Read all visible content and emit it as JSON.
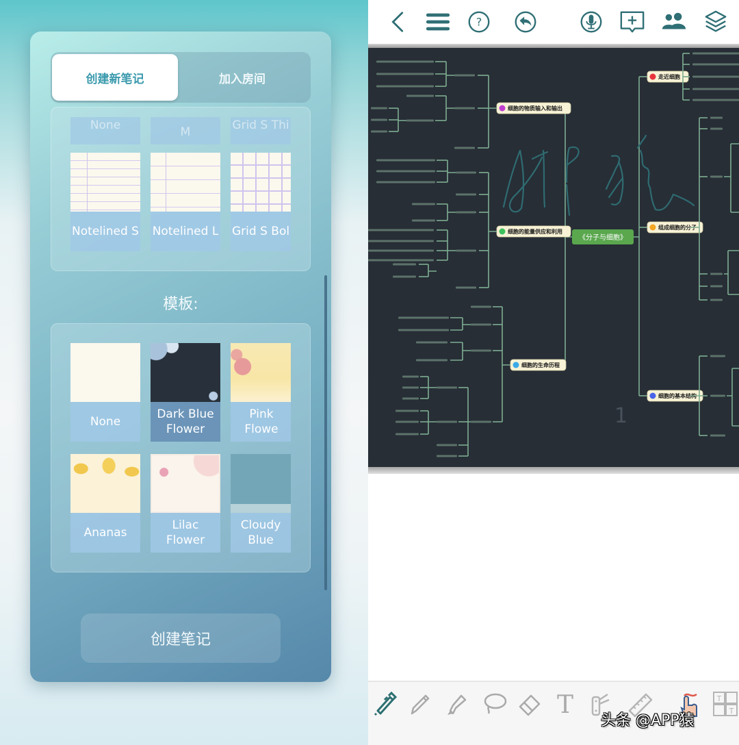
{
  "left_panel": {
    "tabs": [
      {
        "label": "创建新笔记",
        "active": true
      },
      {
        "label": "加入房间",
        "active": false
      }
    ],
    "paper_section": {
      "partial_row": [
        "None",
        "M",
        "Grid S Thi"
      ],
      "items": [
        "Notelined S",
        "Notelined L",
        "Grid S Bol"
      ]
    },
    "template_title": "模板:",
    "templates": [
      {
        "label": "None"
      },
      {
        "label": "Dark Blue\nFlower"
      },
      {
        "label": "Pink Flowe"
      },
      {
        "label": "Ananas"
      },
      {
        "label": "Lilac\nFlower"
      },
      {
        "label": "Cloudy\nBlue"
      }
    ],
    "create_button": "创建笔记"
  },
  "right_panel": {
    "top_toolbar": {
      "icons": [
        "back-chevron-icon",
        "menu-icon",
        "help-icon",
        "undo-icon",
        "microphone-icon",
        "add-comment-icon",
        "users-icon",
        "layers-icon"
      ]
    },
    "mindmap": {
      "center": "《分子与细胞》",
      "branches": [
        {
          "label": "细胞的物质输入和输出",
          "side": "left",
          "dot_color": "#c13fd0"
        },
        {
          "label": "细胞的能量供应和利用",
          "side": "left",
          "dot_color": "#3ec15c"
        },
        {
          "label": "细胞的生命历程",
          "side": "left",
          "dot_color": "#3aa9e8"
        },
        {
          "label": "走近细胞",
          "side": "right",
          "dot_color": "#e8333b"
        },
        {
          "label": "组成细胞的分子",
          "side": "right",
          "dot_color": "#f2a623"
        },
        {
          "label": "细胞的基本结构",
          "side": "right",
          "dot_color": "#4a63e8"
        }
      ],
      "handwriting": "APP猿",
      "page_number": "1"
    },
    "bottom_toolbar": {
      "tools": [
        "pen-icon",
        "pencil-icon",
        "highlighter-icon",
        "lasso-icon",
        "eraser-icon",
        "text-tool-icon",
        "multitool-icon",
        "ruler-icon",
        "touch-gesture-icon",
        "template-grid-icon"
      ],
      "active_tool": "pen-icon"
    },
    "watermark": "头条 @APP猿"
  },
  "colors": {
    "accent_teal": "#2f6f75",
    "tab_active_text": "#3b9aad",
    "canvas_bg": "#272e36",
    "mindmap_line": "#7fae92",
    "center_node": "#5aa74e"
  }
}
